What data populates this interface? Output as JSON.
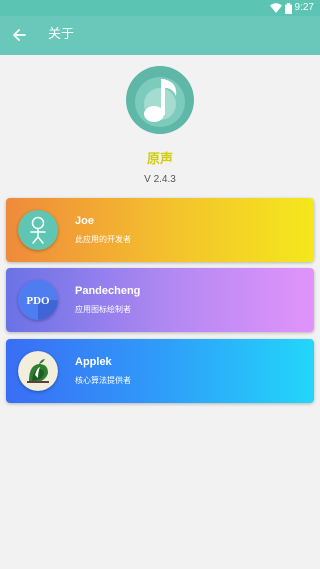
{
  "status_bar": {
    "time": "9:27",
    "icons": [
      "wifi-icon",
      "battery-icon"
    ]
  },
  "app_bar": {
    "back_icon": "arrow-left-icon",
    "title": "关于"
  },
  "app_info": {
    "logo_icon": "music-note-icon",
    "name": "原声",
    "version": "V 2.4.3"
  },
  "colors": {
    "status_bar": "#5cc4b2",
    "app_bar": "#69c8b9",
    "app_name": "#d1cd14",
    "card_1_gradient": [
      "#ef8a3c",
      "#f4e81c"
    ],
    "card_2_gradient": [
      "#6a72e6",
      "#e194fb"
    ],
    "card_3_gradient": [
      "#3a6df5",
      "#22d7f9"
    ]
  },
  "credits": [
    {
      "name": "Joe",
      "role": "此应用的开发者"
    },
    {
      "name": "Pandecheng",
      "role": "应用图标绘制者",
      "avatar_text": "PDO"
    },
    {
      "name": "Applek",
      "role": "核心算法提供者"
    }
  ]
}
